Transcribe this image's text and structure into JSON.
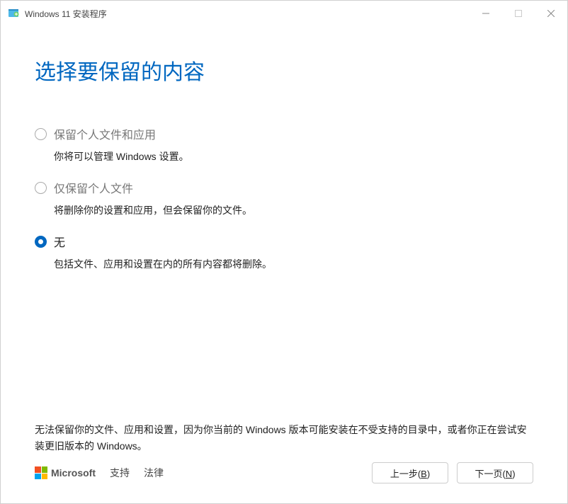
{
  "titlebar": {
    "title": "Windows 11 安装程序"
  },
  "page": {
    "title": "选择要保留的内容"
  },
  "options": [
    {
      "label": "保留个人文件和应用",
      "desc": "你将可以管理 Windows 设置。",
      "selected": false,
      "disabled": true
    },
    {
      "label": "仅保留个人文件",
      "desc": "将删除你的设置和应用，但会保留你的文件。",
      "selected": false,
      "disabled": true
    },
    {
      "label": "无",
      "desc": "包括文件、应用和设置在内的所有内容都将删除。",
      "selected": true,
      "disabled": false
    }
  ],
  "note": "无法保留你的文件、应用和设置，因为你当前的 Windows 版本可能安装在不受支持的目录中，或者你正在尝试安装更旧版本的 Windows。",
  "footer": {
    "ms_label": "Microsoft",
    "support_label": "支持",
    "legal_label": "法律",
    "back_label": "上一步(B)",
    "back_key": "B",
    "next_label": "下一页(N)",
    "next_key": "N"
  }
}
